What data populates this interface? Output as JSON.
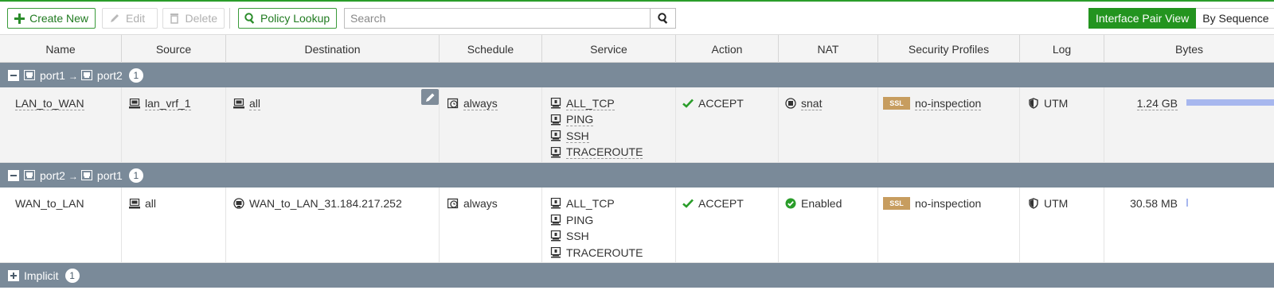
{
  "toolbar": {
    "create_new": "Create New",
    "edit": "Edit",
    "delete": "Delete",
    "policy_lookup": "Policy Lookup",
    "search_placeholder": "Search",
    "view_interface_pair": "Interface Pair View",
    "view_by_sequence": "By Sequence"
  },
  "columns": {
    "name": "Name",
    "source": "Source",
    "destination": "Destination",
    "schedule": "Schedule",
    "service": "Service",
    "action": "Action",
    "nat": "NAT",
    "security_profiles": "Security Profiles",
    "log": "Log",
    "bytes": "Bytes"
  },
  "groups": [
    {
      "from": "port1",
      "to": "port2",
      "count": "1",
      "policy": {
        "name": "LAN_to_WAN",
        "source": "lan_vrf_1",
        "destination": "all",
        "schedule": "always",
        "services": [
          "ALL_TCP",
          "PING",
          "SSH",
          "TRACEROUTE"
        ],
        "action": "ACCEPT",
        "nat": "snat",
        "ssl_badge": "SSL",
        "security_profile": "no-inspection",
        "log": "UTM",
        "bytes": "1.24 GB",
        "bytes_bar_fraction": 1.0
      }
    },
    {
      "from": "port2",
      "to": "port1",
      "count": "1",
      "policy": {
        "name": "WAN_to_LAN",
        "source": "all",
        "destination": "WAN_to_LAN_31.184.217.252",
        "schedule": "always",
        "services": [
          "ALL_TCP",
          "PING",
          "SSH",
          "TRACEROUTE"
        ],
        "action": "ACCEPT",
        "nat": "Enabled",
        "ssl_badge": "SSL",
        "security_profile": "no-inspection",
        "log": "UTM",
        "bytes": "30.58 MB",
        "bytes_bar_fraction": 0.02
      }
    }
  ],
  "implicit": {
    "label": "Implicit",
    "count": "1"
  },
  "colors": {
    "accent_green": "#23941f",
    "group_header": "#7a8a99",
    "bytes_bar": "#a7b7ee",
    "ssl_badge": "#c79d5f"
  }
}
